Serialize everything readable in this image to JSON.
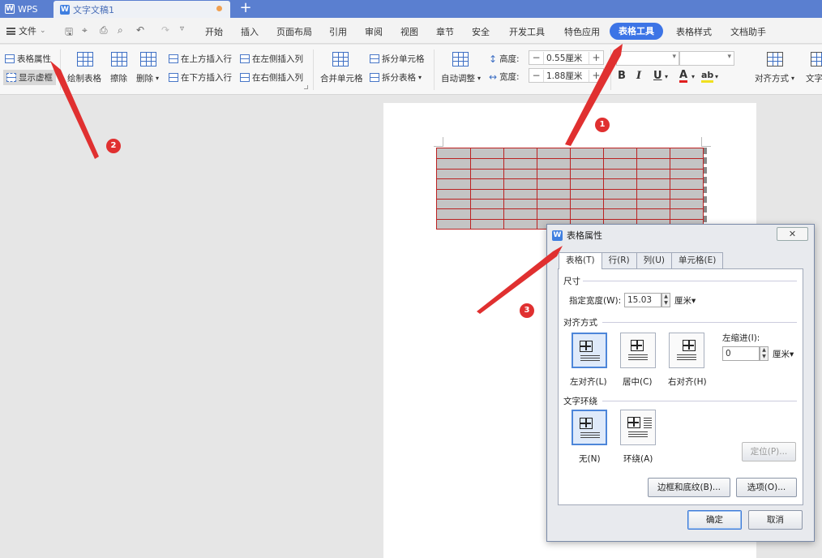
{
  "titlebar": {
    "app_tab": "WPS",
    "doc_tab": "文字文稿1",
    "new_tab_symbol": "+"
  },
  "menubar": {
    "file": "文件",
    "items": [
      "开始",
      "插入",
      "页面布局",
      "引用",
      "审阅",
      "视图",
      "章节",
      "安全",
      "开发工具",
      "特色应用",
      "表格工具",
      "表格样式",
      "文档助手"
    ],
    "active": "表格工具"
  },
  "toolbar": {
    "table_properties": "表格属性",
    "show_gridlines": "显示虚框",
    "draw_table": "绘制表格",
    "erase": "擦除",
    "delete": "删除",
    "insert_row_above": "在上方插入行",
    "insert_row_below": "在下方插入行",
    "insert_col_left": "在左侧插入列",
    "insert_col_right": "在右侧插入列",
    "merge_cells": "合并单元格",
    "split_cells": "拆分单元格",
    "split_table": "拆分表格",
    "auto_fit": "自动调整",
    "height_label": "高度:",
    "height_value": "0.55厘米",
    "width_label": "宽度:",
    "width_value": "1.88厘米",
    "bold": "B",
    "italic": "I",
    "underline": "U",
    "font_color": "A",
    "highlight": "ab",
    "alignment": "对齐方式",
    "text_direction": "文字"
  },
  "dialog": {
    "title": "表格属性",
    "close_symbol": "✕",
    "tabs": [
      "表格(T)",
      "行(R)",
      "列(U)",
      "单元格(E)"
    ],
    "active_tab": "表格(T)",
    "size_section": "尺寸",
    "specified_width_label": "指定宽度(W):",
    "specified_width_value": "15.03",
    "width_unit": "厘米",
    "alignment_section": "对齐方式",
    "align_left": "左对齐(L)",
    "align_center": "居中(C)",
    "align_right": "右对齐(H)",
    "selected_alignment": "左对齐(L)",
    "left_indent_label": "左缩进(I):",
    "left_indent_value": "0",
    "indent_unit": "厘米",
    "wrap_section": "文字环绕",
    "wrap_none": "无(N)",
    "wrap_around": "环绕(A)",
    "selected_wrap": "无(N)",
    "position_button": "定位(P)...",
    "borders_button": "边框和底纹(B)...",
    "options_button": "选项(O)...",
    "ok_button": "确定",
    "cancel_button": "取消"
  },
  "annotations": {
    "badge_1": "1",
    "badge_2": "2",
    "badge_3": "3",
    "color": "#e03030"
  },
  "document_table": {
    "rows": 8,
    "columns": 8,
    "border_color": "#b22222",
    "fill_color": "#c4c4c4"
  },
  "colors": {
    "titlebar": "#5a7fd0",
    "accent": "#3c74e6"
  }
}
